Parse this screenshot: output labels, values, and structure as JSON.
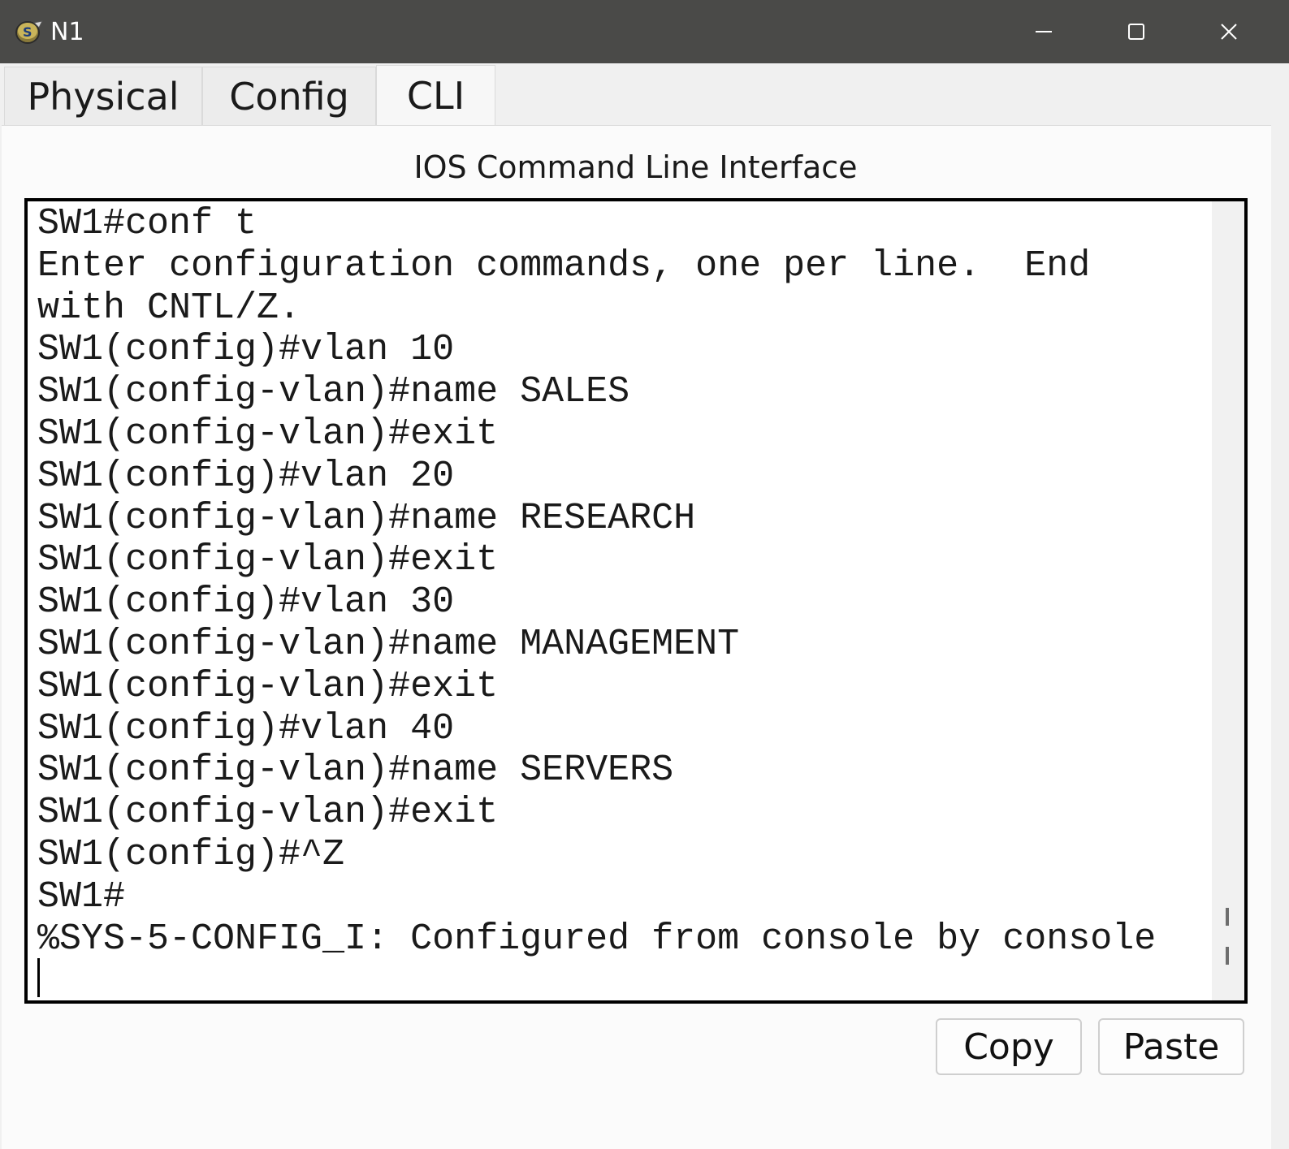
{
  "window": {
    "title": "N1",
    "icon": "router-device-icon",
    "controls": [
      "minimize-icon",
      "maximize-icon",
      "close-icon"
    ]
  },
  "tabs": [
    {
      "label": "Physical",
      "active": false
    },
    {
      "label": "Config",
      "active": false
    },
    {
      "label": "CLI",
      "active": true
    }
  ],
  "panel": {
    "title": "IOS Command Line Interface"
  },
  "console": {
    "lines": [
      "SW1#conf t",
      "Enter configuration commands, one per line.  End",
      "with CNTL/Z.",
      "SW1(config)#vlan 10",
      "SW1(config-vlan)#name SALES",
      "SW1(config-vlan)#exit",
      "SW1(config)#vlan 20",
      "SW1(config-vlan)#name RESEARCH",
      "SW1(config-vlan)#exit",
      "SW1(config)#vlan 30",
      "SW1(config-vlan)#name MANAGEMENT",
      "SW1(config-vlan)#exit",
      "SW1(config)#vlan 40",
      "SW1(config-vlan)#name SERVERS",
      "SW1(config-vlan)#exit",
      "SW1(config)#^Z",
      "SW1#",
      "%SYS-5-CONFIG_I: Configured from console by console"
    ]
  },
  "buttons": {
    "copy_label": "Copy",
    "paste_label": "Paste"
  },
  "colors": {
    "titlebar": "#4a4a48",
    "window_bg": "#f0f0f0",
    "console_bg": "#ffffff",
    "console_border": "#000000"
  }
}
